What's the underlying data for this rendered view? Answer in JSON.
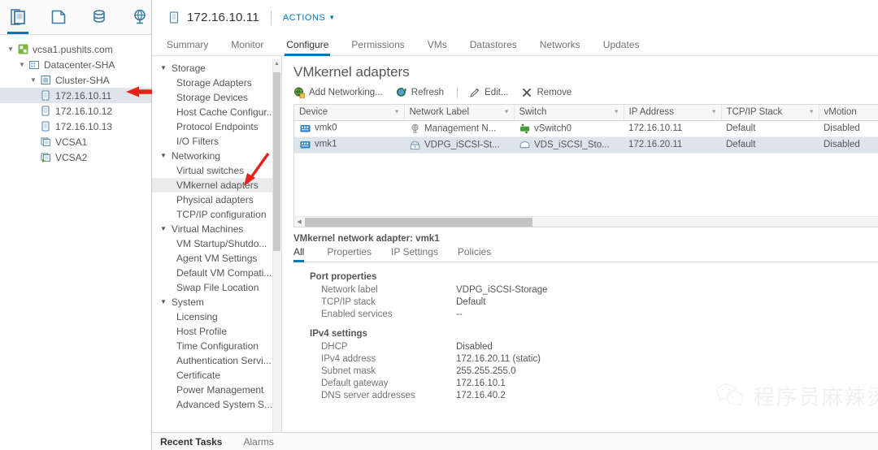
{
  "inventory": {
    "icon_tabs": [
      {
        "name": "hosts-and-clusters-icon",
        "label": "Hosts and Clusters",
        "active": true
      },
      {
        "name": "vms-and-templates-icon",
        "label": "VMs and Templates",
        "active": false
      },
      {
        "name": "storage-icon",
        "label": "Storage",
        "active": false
      },
      {
        "name": "networking-icon",
        "label": "Networking",
        "active": false
      }
    ],
    "tree": [
      {
        "label": "vcsa1.pushits.com",
        "indent": 0,
        "caret": "⌄",
        "icon": "vcenter-icon",
        "selected": false
      },
      {
        "label": "Datacenter-SHA",
        "indent": 1,
        "caret": "⌄",
        "icon": "datacenter-icon",
        "selected": false
      },
      {
        "label": "Cluster-SHA",
        "indent": 2,
        "caret": "⌄",
        "icon": "cluster-icon",
        "selected": false
      },
      {
        "label": "172.16.10.11",
        "indent": 3,
        "caret": "",
        "icon": "host-icon",
        "selected": true
      },
      {
        "label": "172.16.10.12",
        "indent": 3,
        "caret": "",
        "icon": "host-icon",
        "selected": false
      },
      {
        "label": "172.16.10.13",
        "indent": 3,
        "caret": "",
        "icon": "host-icon",
        "selected": false
      },
      {
        "label": "VCSA1",
        "indent": 3,
        "caret": "",
        "icon": "vm-icon",
        "selected": false
      },
      {
        "label": "VCSA2",
        "indent": 3,
        "caret": "",
        "icon": "vm-running-icon",
        "selected": false
      }
    ]
  },
  "object_header": {
    "title": "172.16.10.11",
    "actions_label": "ACTIONS",
    "caret": "⌄"
  },
  "tabs": [
    {
      "label": "Summary",
      "active": false
    },
    {
      "label": "Monitor",
      "active": false
    },
    {
      "label": "Configure",
      "active": true
    },
    {
      "label": "Permissions",
      "active": false
    },
    {
      "label": "VMs",
      "active": false
    },
    {
      "label": "Datastores",
      "active": false
    },
    {
      "label": "Networks",
      "active": false
    },
    {
      "label": "Updates",
      "active": false
    }
  ],
  "subnav": [
    {
      "label": "Storage",
      "type": "group",
      "caret": "▾"
    },
    {
      "label": "Storage Adapters",
      "type": "item"
    },
    {
      "label": "Storage Devices",
      "type": "item"
    },
    {
      "label": "Host Cache Configur...",
      "type": "item"
    },
    {
      "label": "Protocol Endpoints",
      "type": "item"
    },
    {
      "label": "I/O Filters",
      "type": "item"
    },
    {
      "label": "Networking",
      "type": "group",
      "caret": "▾"
    },
    {
      "label": "Virtual switches",
      "type": "item"
    },
    {
      "label": "VMkernel adapters",
      "type": "item",
      "selected": true
    },
    {
      "label": "Physical adapters",
      "type": "item"
    },
    {
      "label": "TCP/IP configuration",
      "type": "item"
    },
    {
      "label": "Virtual Machines",
      "type": "group",
      "caret": "▾"
    },
    {
      "label": "VM Startup/Shutdo...",
      "type": "item"
    },
    {
      "label": "Agent VM Settings",
      "type": "item"
    },
    {
      "label": "Default VM Compati...",
      "type": "item"
    },
    {
      "label": "Swap File Location",
      "type": "item"
    },
    {
      "label": "System",
      "type": "group",
      "caret": "▾"
    },
    {
      "label": "Licensing",
      "type": "item"
    },
    {
      "label": "Host Profile",
      "type": "item"
    },
    {
      "label": "Time Configuration",
      "type": "item"
    },
    {
      "label": "Authentication Servi...",
      "type": "item"
    },
    {
      "label": "Certificate",
      "type": "item"
    },
    {
      "label": "Power Management",
      "type": "item"
    },
    {
      "label": "Advanced System S...",
      "type": "item"
    }
  ],
  "content": {
    "title": "VMkernel adapters",
    "toolbar": [
      {
        "label": "Add Networking...",
        "icon": "add-networking-icon"
      },
      {
        "label": "Refresh",
        "icon": "refresh-icon"
      },
      {
        "label": "Edit...",
        "icon": "edit-pencil-icon",
        "sep_before": true
      },
      {
        "label": "Remove",
        "icon": "remove-x-icon"
      }
    ],
    "table": {
      "columns": [
        {
          "label": "Device",
          "filter": true
        },
        {
          "label": "Network Label",
          "filter": true
        },
        {
          "label": "Switch",
          "filter": true
        },
        {
          "label": "IP Address",
          "filter": true
        },
        {
          "label": "TCP/IP Stack",
          "filter": true
        },
        {
          "label": "vMotion",
          "filter": false
        }
      ],
      "rows": [
        {
          "device": "vmk0",
          "device_icon": "vmkernel-adapter-icon",
          "network_label": "Management N...",
          "network_icon": "management-network-icon",
          "switch": "vSwitch0",
          "switch_icon": "standard-switch-icon",
          "ip_address": "172.16.10.11",
          "tcpip_stack": "Default",
          "vmotion": "Disabled",
          "selected": false
        },
        {
          "device": "vmk1",
          "device_icon": "vmkernel-adapter-icon",
          "network_label": "VDPG_iSCSI-St...",
          "network_icon": "port-group-icon",
          "switch": "VDS_iSCSI_Sto...",
          "switch_icon": "distributed-switch-icon",
          "ip_address": "172.16.20.11",
          "tcpip_stack": "Default",
          "vmotion": "Disabled",
          "selected": true
        }
      ]
    }
  },
  "details": {
    "title": "VMkernel network adapter: vmk1",
    "tabs": [
      {
        "label": "All",
        "active": true
      },
      {
        "label": "Properties",
        "active": false
      },
      {
        "label": "IP Settings",
        "active": false
      },
      {
        "label": "Policies",
        "active": false
      }
    ],
    "sections": [
      {
        "title": "Port properties",
        "rows": [
          {
            "key": "Network label",
            "value": "VDPG_iSCSI-Storage"
          },
          {
            "key": "TCP/IP stack",
            "value": "Default"
          },
          {
            "key": "Enabled services",
            "value": "--"
          }
        ]
      },
      {
        "title": "IPv4 settings",
        "rows": [
          {
            "key": "DHCP",
            "value": "Disabled"
          },
          {
            "key": "IPv4 address",
            "value": "172.16.20.11 (static)"
          },
          {
            "key": "Subnet mask",
            "value": "255.255.255.0"
          },
          {
            "key": "Default gateway",
            "value": "172.16.10.1"
          },
          {
            "key": "DNS server addresses",
            "value": "172.16.40.2"
          }
        ]
      }
    ]
  },
  "watermark": {
    "text": "程序员麻辣烫",
    "icon": "wechat-icon"
  },
  "bottombar": {
    "items": [
      {
        "label": "Recent Tasks",
        "active": true
      },
      {
        "label": "Alarms",
        "active": false
      }
    ],
    "expand": "⤢"
  },
  "colors": {
    "accent": "#0079b8",
    "selection": "#dde5ea",
    "annotation_red": "#e02020",
    "text": "#565656"
  }
}
